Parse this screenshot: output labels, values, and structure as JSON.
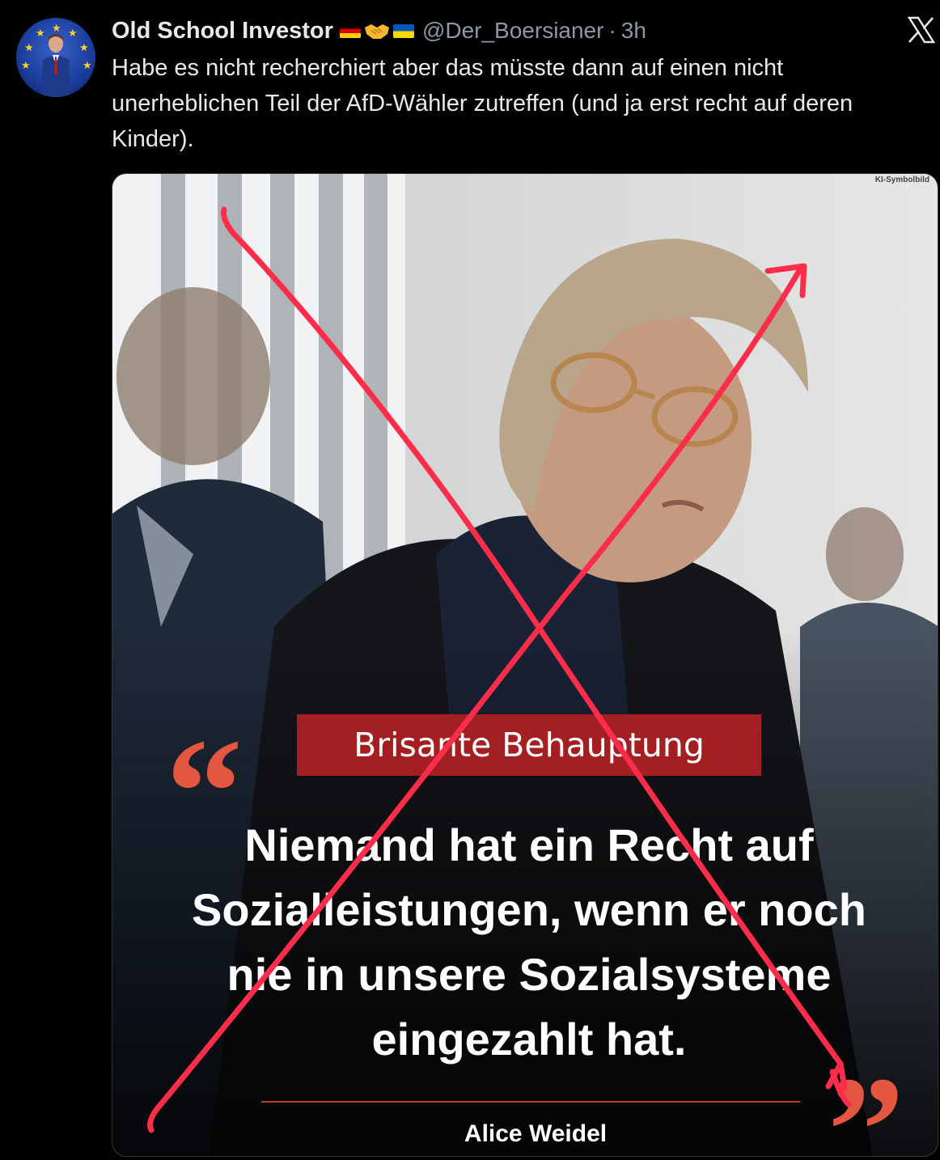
{
  "author": {
    "display_name": "Old School Investor",
    "handle": "@Der_Boersianer",
    "separator": "·",
    "time": "3h"
  },
  "icons": {
    "avatar": "avatar-icon",
    "flag_germany": "flag-germany-icon",
    "handshake": "handshake-icon",
    "flag_ukraine": "flag-ukraine-icon",
    "x_logo": "x-logo-icon"
  },
  "tweet": {
    "text": "Habe es nicht recherchiert aber das müsste dann auf einen nicht unerheblichen Teil der AfD-Wähler zutreffen (und ja erst recht auf deren Kinder)."
  },
  "media": {
    "corner_label": "KI-Symbolbild",
    "badge": "Brisante Behauptung",
    "quote": "Niemand hat ein Recht auf Sozialleistungen, wenn er noch nie in unsere Sozialsysteme eingezahlt hat.",
    "quote_author": "Alice Weidel",
    "accent_color": "#a31f22",
    "cross_color": "#ff2d4a"
  }
}
